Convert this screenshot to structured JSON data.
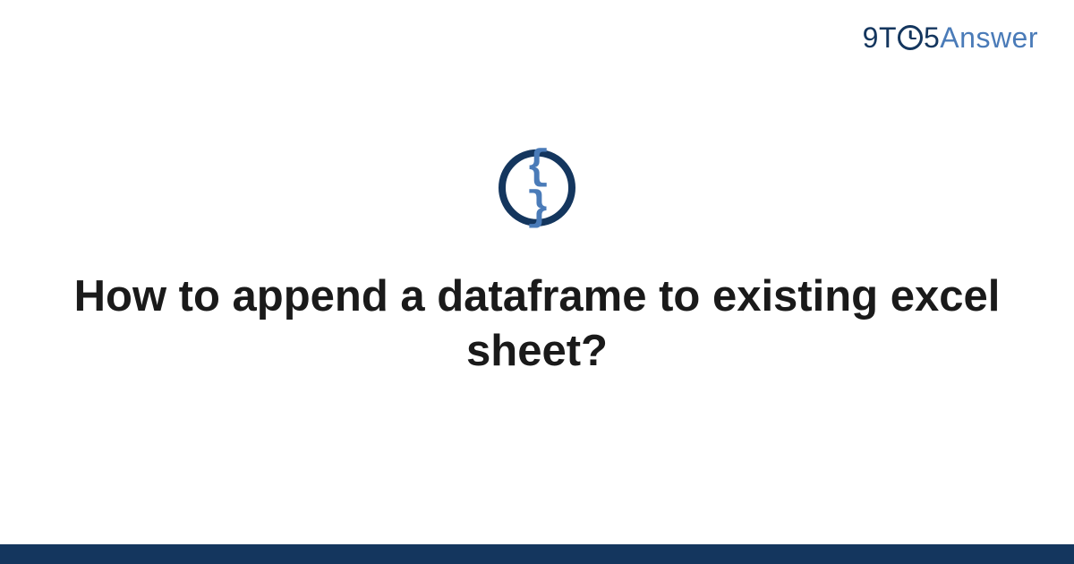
{
  "logo": {
    "part1": "9T",
    "part2": "5",
    "part3": "Answer"
  },
  "icon": {
    "braces": "{ }"
  },
  "question": {
    "title": "How to append a dataframe to existing excel sheet?"
  },
  "colors": {
    "primary": "#14365e",
    "accent": "#4a7bb8"
  }
}
